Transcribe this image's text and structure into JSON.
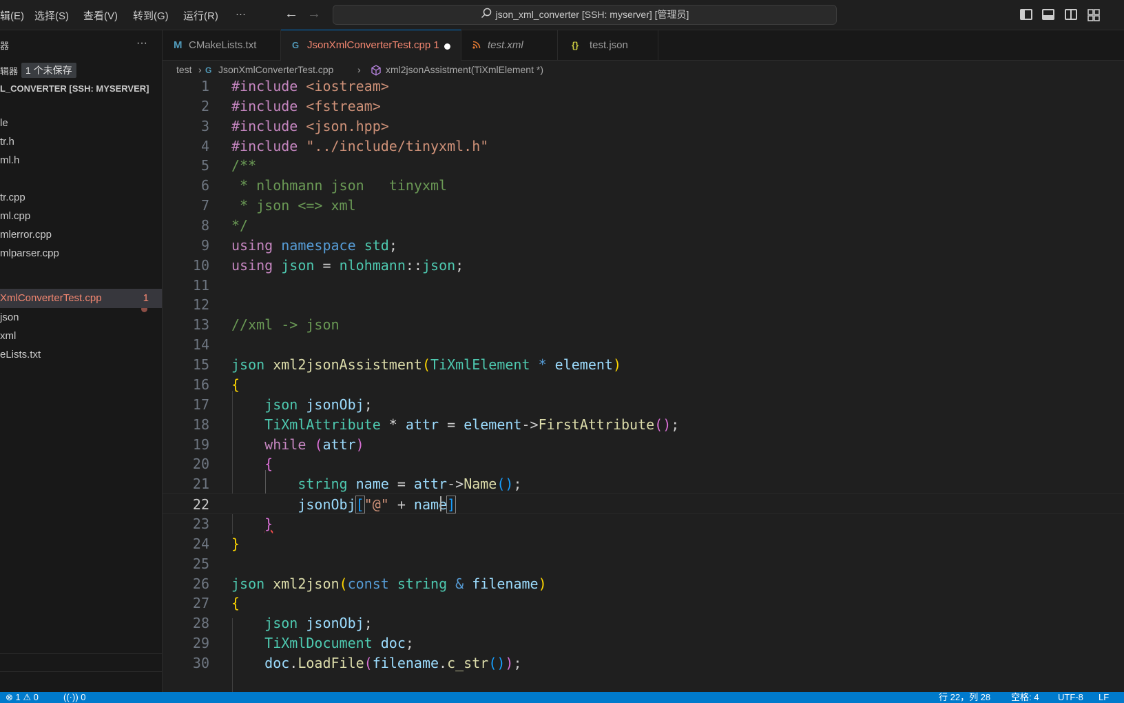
{
  "menubar": {
    "items": [
      "辑(E)",
      "选择(S)",
      "查看(V)",
      "转到(G)",
      "运行(R)"
    ],
    "more": "···"
  },
  "command_center": {
    "text": "json_xml_converter [SSH: myserver] [管理员]",
    "icon": "search-icon"
  },
  "sidebar": {
    "section_title": "器",
    "more": "···",
    "open_editors_label": "辑器",
    "unsaved_badge": "1 个未保存",
    "workspace_title": "L_CONVERTER [SSH: MYSERVER]",
    "files": [
      {
        "label": "le"
      },
      {
        "label": "tr.h"
      },
      {
        "label": "ml.h"
      },
      {
        "label": "tr.cpp"
      },
      {
        "label": "ml.cpp"
      },
      {
        "label": "mlerror.cpp"
      },
      {
        "label": "mlparser.cpp"
      },
      {
        "label": "XmlConverterTest.cpp",
        "problems": "1",
        "active": true
      },
      {
        "label": "json"
      },
      {
        "label": "xml"
      },
      {
        "label": "eLists.txt"
      }
    ]
  },
  "tabs": [
    {
      "icon": "M",
      "icon_color": "#519aba",
      "label": "CMakeLists.txt",
      "italic": false
    },
    {
      "icon": "G",
      "icon_color": "#519aba",
      "label": "JsonXmlConverterTest.cpp",
      "problems": "1",
      "active": true,
      "dirty": true
    },
    {
      "icon": "≋",
      "icon_color": "#e37933",
      "label": "test.xml",
      "italic": true
    },
    {
      "icon": "{}",
      "icon_color": "#cbcb41",
      "label": "test.json",
      "italic": false
    }
  ],
  "breadcrumb": {
    "folder": "test",
    "file": "JsonXmlConverterTest.cpp",
    "symbol": "xml2jsonAssistment(TiXmlElement *)"
  },
  "editor": {
    "current_line": 22,
    "lines": [
      {
        "n": "1"
      },
      {
        "n": "2"
      },
      {
        "n": "3"
      },
      {
        "n": "4"
      },
      {
        "n": "5"
      },
      {
        "n": "6"
      },
      {
        "n": "7"
      },
      {
        "n": "8"
      },
      {
        "n": "9"
      },
      {
        "n": "10"
      },
      {
        "n": "11"
      },
      {
        "n": "12"
      },
      {
        "n": "13"
      },
      {
        "n": "14"
      },
      {
        "n": "15"
      },
      {
        "n": "16"
      },
      {
        "n": "17"
      },
      {
        "n": "18"
      },
      {
        "n": "19"
      },
      {
        "n": "20"
      },
      {
        "n": "21"
      },
      {
        "n": "22"
      },
      {
        "n": "23"
      },
      {
        "n": "24"
      },
      {
        "n": "25"
      },
      {
        "n": "26"
      },
      {
        "n": "27"
      },
      {
        "n": "28"
      },
      {
        "n": "29"
      },
      {
        "n": "30"
      }
    ]
  },
  "statusbar": {
    "errors": "⊗ 1 ⚠ 0",
    "ports": "0",
    "position": "行 22，列 28",
    "spaces": "空格: 4",
    "encoding": "UTF-8",
    "eol": "LF"
  },
  "colors": {
    "accent": "#007acc",
    "error": "#f48771"
  }
}
